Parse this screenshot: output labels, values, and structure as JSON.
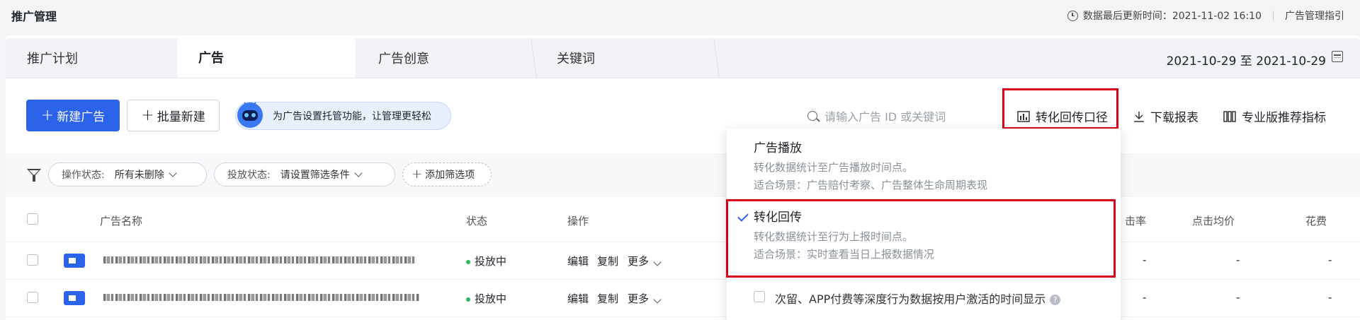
{
  "header": {
    "title": "推广管理",
    "update_time": "数据最后更新时间：2021-11-02 16:10",
    "guide_link": "广告管理指引"
  },
  "tabs": [
    {
      "label": "推广计划"
    },
    {
      "label": "广告",
      "active": true
    },
    {
      "label": "广告创意"
    },
    {
      "label": "关键词"
    }
  ],
  "date_range": "2021-10-29 至 2021-10-29",
  "toolbar": {
    "new_ad": "新建广告",
    "batch_new": "批量新建",
    "hosting_tip": "为广告设置托管功能，让管理更轻松",
    "search_placeholder": "请输入广告 ID 或关键词",
    "conversion_caliber": "转化回传口径",
    "download_report": "下载报表",
    "pro_metrics": "专业版推荐指标"
  },
  "filters": {
    "op_status_label": "操作状态:",
    "op_status_value": "所有未删除",
    "delivery_status_label": "投放状态:",
    "delivery_status_value": "请设置筛选条件",
    "add_filter": "添加筛选项"
  },
  "table": {
    "headers": {
      "name": "广告名称",
      "status": "状态",
      "operation": "操作",
      "ctr": "击率",
      "cpc": "点击均价",
      "cost": "花费"
    },
    "rows": [
      {
        "status": "投放中",
        "edit": "编辑",
        "copy": "复制",
        "more": "更多",
        "ctr": "-",
        "cpc": "-",
        "cost": "-",
        "extra": "-"
      },
      {
        "status": "投放中",
        "edit": "编辑",
        "copy": "复制",
        "more": "更多",
        "ctr": "-",
        "cpc": "-",
        "cost": "-",
        "extra": "-"
      }
    ]
  },
  "dropdown": {
    "options": [
      {
        "title": "广告播放",
        "desc1": "转化数据统计至广告播放时间点。",
        "desc2": "适合场景：广告赔付考察、广告整体生命周期表现",
        "selected": false
      },
      {
        "title": "转化回传",
        "desc1": "转化数据统计至行为上报时间点。",
        "desc2": "适合场景：实时查看当日上报数据情况",
        "selected": true
      }
    ],
    "deep_option": "次留、APP付费等深度行为数据按用户激活的时间显示",
    "help_glyph": "?"
  },
  "colors": {
    "primary": "#2b63eb",
    "highlight": "#d9001b",
    "running": "#2db55d"
  }
}
